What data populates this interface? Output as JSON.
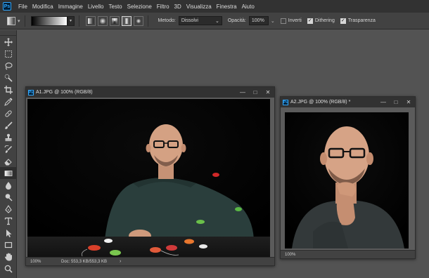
{
  "app": {
    "logo": "Ps"
  },
  "menu": [
    "File",
    "Modifica",
    "Immagine",
    "Livello",
    "Testo",
    "Selezione",
    "Filtro",
    "3D",
    "Visualizza",
    "Finestra",
    "Aiuto"
  ],
  "options": {
    "mode_label": "Metodo:",
    "mode_value": "Dissolvi",
    "opacity_label": "Opacità:",
    "opacity_value": "100%",
    "reverse_label": "Inverti",
    "reverse_checked": false,
    "dither_label": "Dithering",
    "dither_checked": true,
    "transparency_label": "Trasparenza",
    "transparency_checked": true,
    "gradient_types": [
      "linear",
      "radial",
      "angle",
      "reflected",
      "diamond"
    ],
    "active_gradient_type": "reflected"
  },
  "tools": [
    "move",
    "marquee",
    "lasso",
    "quick-selection",
    "crop",
    "eyedropper",
    "healing",
    "brush",
    "clone-stamp",
    "history-brush",
    "eraser",
    "gradient",
    "blur",
    "dodge",
    "pen",
    "type",
    "path-selection",
    "rectangle",
    "hand",
    "zoom"
  ],
  "active_tool": "gradient",
  "doc1": {
    "title": "A1.JPG @ 100% (RGB/8)",
    "zoom": "100%",
    "doc_info": "Doc: 553,3 KB/553,3 KB",
    "arrow": "›"
  },
  "doc2": {
    "title": "A2.JPG @ 100% (RGB/8) *",
    "zoom": "100%"
  },
  "window_controls": {
    "minimize": "—",
    "maximize": "□",
    "close": "✕"
  }
}
